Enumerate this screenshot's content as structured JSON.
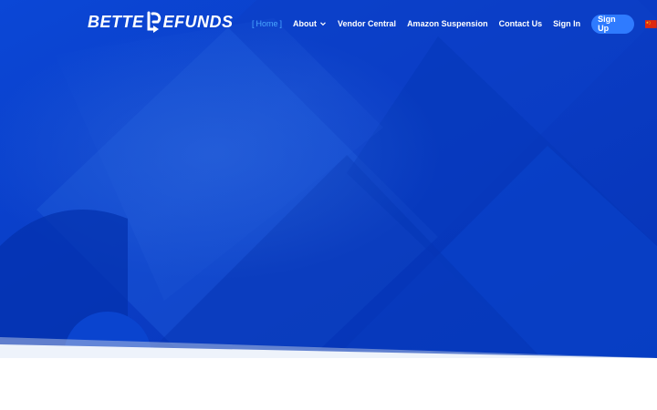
{
  "brand": {
    "logo_part_a": "BETTE",
    "logo_part_b": "EFUNDS"
  },
  "nav": {
    "home_bracket_open": "[",
    "home_label": "Home",
    "home_bracket_close": "]",
    "about_label": "About",
    "vendor_label": "Vendor Central",
    "suspension_label": "Amazon Suspension",
    "contact_label": "Contact Us",
    "signin_label": "Sign In",
    "signup_label": "Sign Up"
  },
  "icons": {
    "logo_mark": "refund-arrow-icon",
    "about_dropdown": "chevron-down-icon",
    "language": "china-flag-icon"
  },
  "colors": {
    "hero_base": "#0a3ec8",
    "hero_dark": "#0231a8",
    "accent": "#4aa7ff",
    "signup_button": "#2f7bff",
    "white": "#ffffff"
  }
}
